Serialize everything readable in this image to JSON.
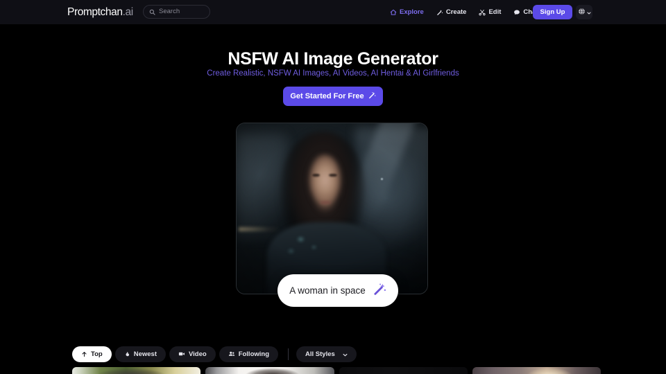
{
  "header": {
    "logo": {
      "main": "Promptchan",
      "suffix": ".ai"
    },
    "search": {
      "placeholder": "Search",
      "value": "",
      "icon": "search-icon"
    },
    "nav": [
      {
        "label": "Explore",
        "icon": "home-icon",
        "active": true
      },
      {
        "label": "Create",
        "icon": "magic-wand-icon",
        "active": false
      },
      {
        "label": "Edit",
        "icon": "scissors-icon",
        "active": false
      },
      {
        "label": "Chat",
        "icon": "chat-bubble-icon",
        "active": false
      }
    ],
    "signup_label": "Sign Up",
    "language": {
      "icon": "globe-icon",
      "chevron": "chevron-down-icon"
    }
  },
  "hero": {
    "title": "NSFW AI Image Generator",
    "subtitle": "Create Realistic, NSFW AI Images, AI Videos, AI Hentai & AI Girlfriends",
    "cta_label": "Get Started For Free",
    "cta_icon": "magic-wand-icon",
    "video_prompt": "A woman in space",
    "video_prompt_icon": "magic-wand-icon"
  },
  "filters": {
    "tabs": [
      {
        "label": "Top",
        "icon": "arrow-up-icon",
        "active": true
      },
      {
        "label": "Newest",
        "icon": "flame-icon",
        "active": false
      },
      {
        "label": "Video",
        "icon": "video-camera-icon",
        "active": false
      },
      {
        "label": "Following",
        "icon": "people-icon",
        "active": false
      }
    ],
    "styles_dropdown": {
      "label": "All Styles",
      "chevron": "chevron-down-icon"
    }
  },
  "gallery": {
    "cards": [
      {
        "name": "gallery-card-1"
      },
      {
        "name": "gallery-card-2"
      },
      {
        "name": "gallery-card-3"
      },
      {
        "name": "gallery-card-4"
      }
    ]
  },
  "colors": {
    "accent_purple": "#5b4ae8",
    "subtitle_purple": "#6f5de0",
    "active_nav_purple": "#7d6df0",
    "header_bg": "#0f0f15",
    "page_bg": "#000000",
    "chip_bg": "#17171d"
  }
}
